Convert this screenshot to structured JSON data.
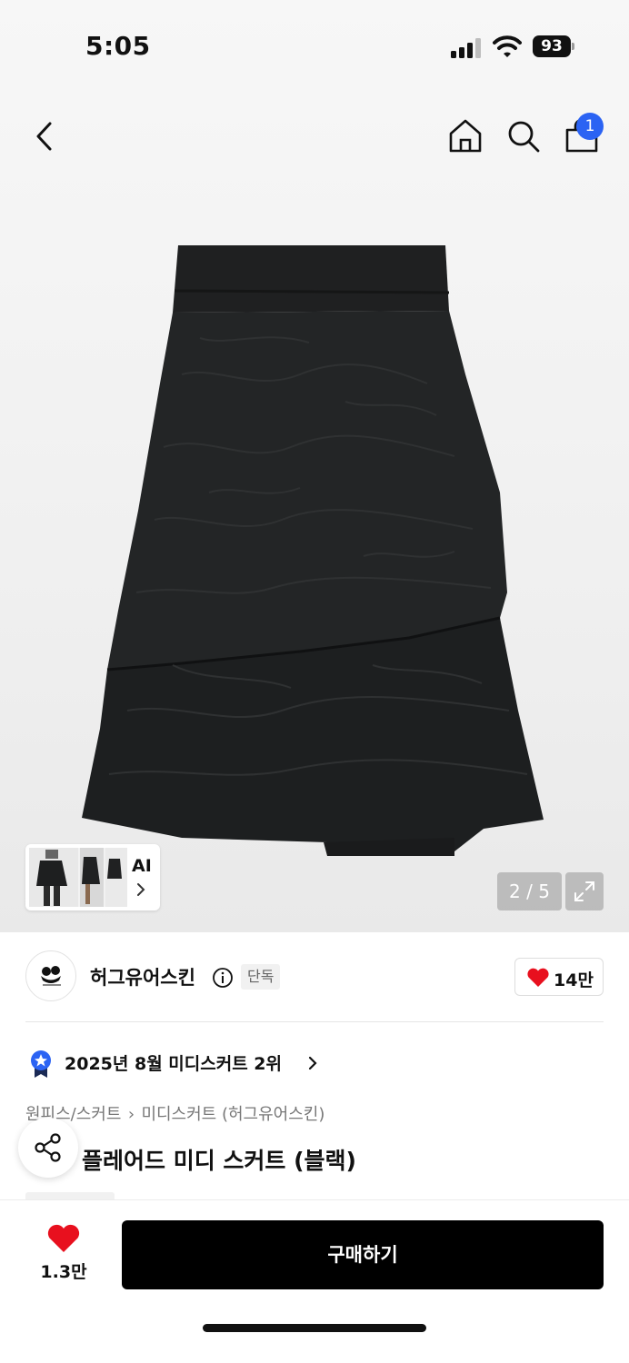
{
  "status_bar": {
    "time": "5:05",
    "battery": "93"
  },
  "header": {
    "cart_count": "1"
  },
  "gallery": {
    "ai_label": "AI",
    "page_counter": "2 / 5"
  },
  "brand": {
    "name": "허그유어스킨",
    "badge": "단독",
    "like_count": "14만"
  },
  "ranking": {
    "text": "2025년 8월 미디스커트 2위"
  },
  "breadcrumb": {
    "items": [
      "원피스/스커트",
      "미디스커트 (허그유어스킨)"
    ]
  },
  "product": {
    "title": "플레어드 미디 스커트 (블랙)"
  },
  "bottom_bar": {
    "like_count": "1.3만",
    "buy_label": "구매하기"
  },
  "colors": {
    "accent": "#2b63f3",
    "heart": "#e8101e",
    "button": "#000000"
  }
}
